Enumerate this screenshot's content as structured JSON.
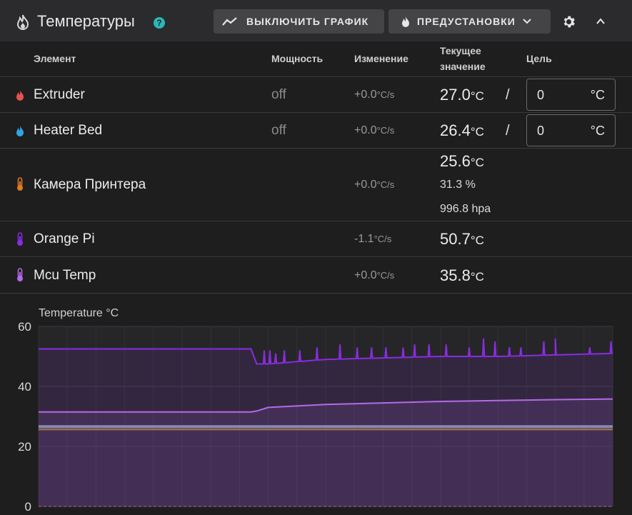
{
  "header": {
    "title": "Температуры",
    "help_glyph": "?",
    "toggle_chart_label": "ВЫКЛЮЧИТЬ ГРАФИК",
    "presets_label": "ПРЕДУСТАНОВКИ",
    "icons": {
      "title": "fire-icon",
      "chart": "chart-line-icon",
      "presets": "fire-icon",
      "settings": "gear-icon",
      "collapse": "chevron-up-icon"
    }
  },
  "columns": {
    "element": "Элемент",
    "power": "Мощность",
    "change": "Изменение",
    "current_line1": "Текущее",
    "current_line2": "значение",
    "target": "Цель"
  },
  "rows": [
    {
      "name": "Extruder",
      "icon": "fire-icon",
      "icon_color": "#e8534f",
      "power": "off",
      "change": "+0.0",
      "change_unit": "°C/s",
      "current": "27.0",
      "current_unit": "°C",
      "slash": "/",
      "target_value": "0",
      "target_unit": "°C"
    },
    {
      "name": "Heater Bed",
      "icon": "fire-icon",
      "icon_color": "#2ea6e8",
      "power": "off",
      "change": "+0.0",
      "change_unit": "°C/s",
      "current": "26.4",
      "current_unit": "°C",
      "slash": "/",
      "target_value": "0",
      "target_unit": "°C"
    },
    {
      "name": "Камера Принтера",
      "icon": "thermometer-icon",
      "icon_color": "#e07b1f",
      "change": "+0.0",
      "change_unit": "°C/s",
      "current": "25.6",
      "current_unit": "°C",
      "humidity": "31.3 %",
      "pressure": "996.8 hpa"
    },
    {
      "name": "Orange Pi",
      "icon": "thermometer-icon",
      "icon_color": "#8a2be2",
      "change": "-1.1",
      "change_unit": "°C/s",
      "current": "50.7",
      "current_unit": "°C"
    },
    {
      "name": "Mcu Temp",
      "icon": "thermometer-icon",
      "icon_color": "#b46ae8",
      "change": "+0.0",
      "change_unit": "°C/s",
      "current": "35.8",
      "current_unit": "°C"
    }
  ],
  "chart_data": {
    "type": "line",
    "title": "Temperature °C",
    "ylim": [
      0,
      60
    ],
    "yticks": [
      0,
      20,
      40,
      60
    ],
    "grid": true,
    "x": [
      0,
      10,
      20,
      30,
      37,
      38,
      40,
      50,
      60,
      70,
      80,
      90,
      100
    ],
    "series": [
      {
        "color": "#8a2be2",
        "values": [
          52.5,
          52.5,
          52.5,
          52.5,
          52.5,
          47.5,
          47.5,
          49,
          49.5,
          50,
          50,
          50.5,
          51
        ]
      },
      {
        "color": "#b46ae8",
        "values": [
          31.5,
          31.5,
          31.5,
          31.5,
          31.5,
          31.8,
          33,
          34,
          34.5,
          35,
          35.3,
          35.6,
          35.8
        ]
      },
      {
        "color": "#9bb9d8",
        "values": [
          26.8,
          26.8,
          26.8,
          26.8,
          26.8,
          26.8,
          26.8,
          26.8,
          26.8,
          26.8,
          26.8,
          26.8,
          26.8
        ]
      },
      {
        "color": "#e8534f",
        "values": [
          26.4,
          26.4,
          26.4,
          26.4,
          26.4,
          26.4,
          26.4,
          26.4,
          26.4,
          26.4,
          26.4,
          26.4,
          26.4
        ]
      },
      {
        "color": "#2ea6e8",
        "values": [
          26.2,
          26.2,
          26.2,
          26.2,
          26.2,
          26.2,
          26.2,
          26.2,
          26.2,
          26.2,
          26.2,
          26.2,
          26.2
        ]
      },
      {
        "color": "#e07b1f",
        "values": [
          25.6,
          25.6,
          25.6,
          25.6,
          25.6,
          25.6,
          25.6,
          25.6,
          25.6,
          25.6,
          25.6,
          25.6,
          25.6
        ]
      }
    ],
    "spikes": {
      "series_index": 0,
      "x": [
        39.3,
        40.3,
        41.3,
        42.8,
        45.5,
        48.5,
        52.5,
        55.5,
        58,
        60.5,
        63.5,
        65.5,
        68,
        71,
        75,
        77.5,
        79.5,
        82,
        84,
        88,
        90,
        96,
        99.7
      ],
      "values": [
        52,
        52,
        51,
        52,
        52,
        53,
        54,
        53,
        53,
        53,
        53,
        54,
        54,
        54,
        53,
        56,
        55,
        53,
        53,
        55,
        56,
        53,
        55
      ]
    }
  }
}
